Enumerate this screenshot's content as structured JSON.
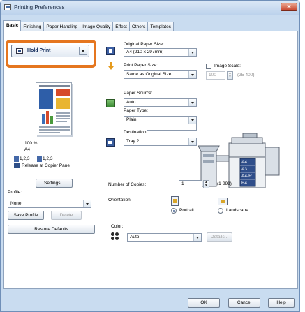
{
  "window": {
    "title": "Printing Preferences",
    "close_label": "✕"
  },
  "tabs": [
    "Basic",
    "Finishing",
    "Paper Handling",
    "Image Quality",
    "Effect",
    "Others",
    "Templates"
  ],
  "left": {
    "print_job": "Hold Print",
    "zoom": "100 %",
    "paper": "A4",
    "page_a": "1,2,3",
    "page_b": "1,2,3",
    "release_label": "Release at Copier Panel",
    "settings_button": "Settings...",
    "profile_label": "Profile:",
    "profile_value": "None",
    "save_profile_button": "Save Profile",
    "delete_button": "Delete",
    "restore_button": "Restore Defaults"
  },
  "form": {
    "original_paper_size_label": "Original Paper Size:",
    "original_paper_size_value": "A4 (210 x 297mm)",
    "print_paper_size_label": "Print Paper Size:",
    "print_paper_size_value": "Same as Original Size",
    "image_scale_label": "Image Scale:",
    "image_scale_value": "100",
    "image_scale_range": "(25-400)",
    "paper_source_label": "Paper Source:",
    "paper_source_value": "Auto",
    "paper_type_label": "Paper Type:",
    "paper_type_value": "Plain",
    "destination_label": "Destination:",
    "destination_value": "Tray 2",
    "copies_label": "Number of Copies:",
    "copies_value": "1",
    "copies_range": "(1-999)",
    "orientation_label": "Orientation:",
    "portrait_label": "Portrait",
    "landscape_label": "Landscape",
    "color_label": "Color:",
    "color_value": "Auto",
    "details_button": "Details..."
  },
  "printer_trays": [
    "A4",
    "A3",
    "A4-R",
    "B4"
  ],
  "footer": {
    "ok": "OK",
    "cancel": "Cancel",
    "help": "Help"
  },
  "colors": {
    "highlight": "#e5761f",
    "chrome": "#c9dcf0",
    "accent": "#2e4f88"
  },
  "icons": [
    "printer-app-icon",
    "close-icon",
    "hold-print-icon",
    "paper-size-icon",
    "print-paper-icon",
    "paper-source-icon",
    "destination-icon",
    "portrait-icon",
    "landscape-icon",
    "color-icon"
  ]
}
